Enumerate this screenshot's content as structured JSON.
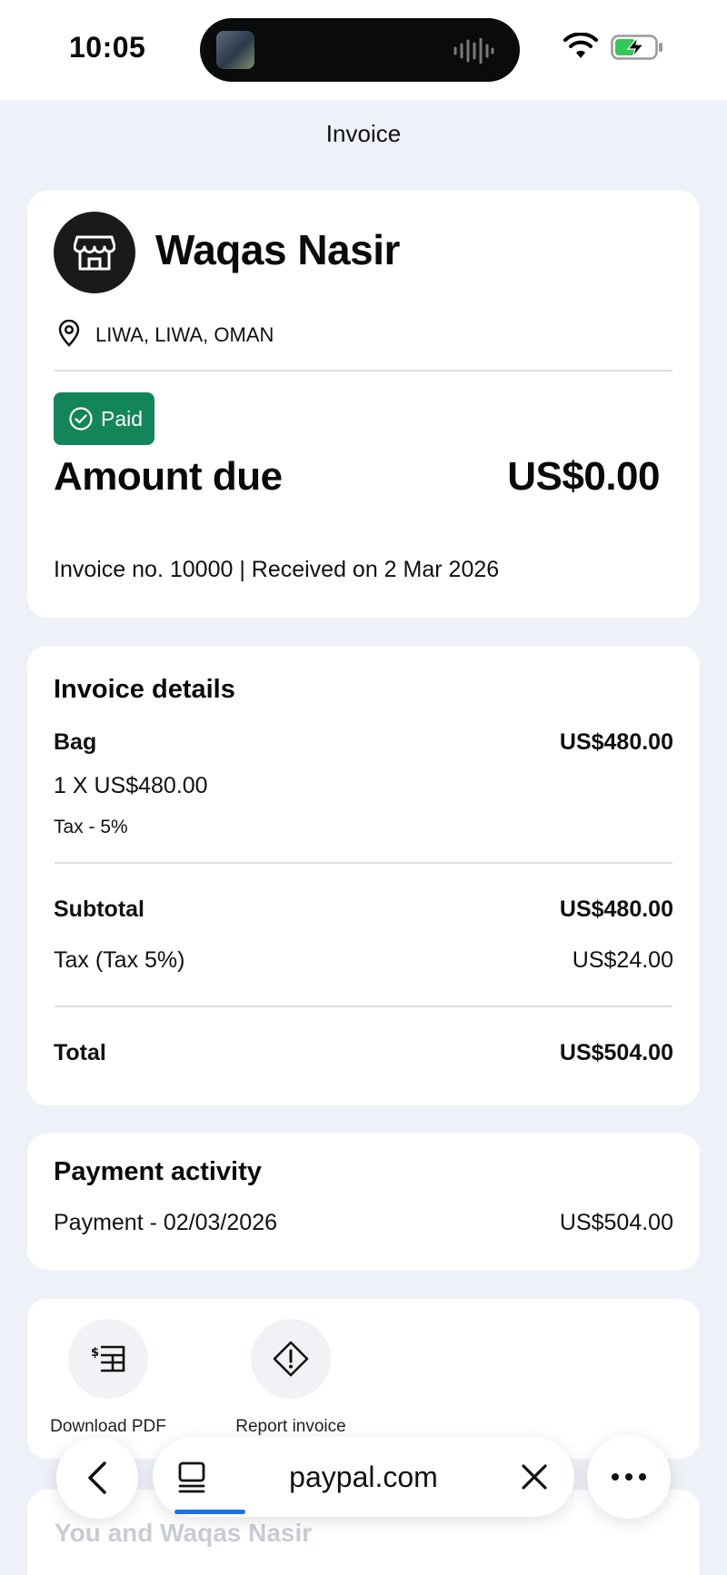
{
  "status_bar": {
    "time": "10:05"
  },
  "nav": {
    "title": "Invoice"
  },
  "merchant": {
    "name": "Waqas Nasir",
    "location": "LIWA, LIWA, OMAN"
  },
  "summary": {
    "status": "Paid",
    "amount_label": "Amount due",
    "amount_value": "US$0.00",
    "meta": "Invoice no. 10000 | Received on 2 Mar 2026",
    "status_color": "#12865a"
  },
  "details": {
    "title": "Invoice details",
    "item": {
      "name": "Bag",
      "amount": "US$480.00",
      "qty_price": "1 X US$480.00",
      "tax": "Tax - 5%"
    },
    "subtotal": {
      "label": "Subtotal",
      "value": "US$480.00"
    },
    "tax_line": {
      "label": "Tax (Tax 5%)",
      "value": "US$24.00"
    },
    "total": {
      "label": "Total",
      "value": "US$504.00"
    }
  },
  "payments": {
    "title": "Payment activity",
    "rows": [
      {
        "label": "Payment - 02/03/2026",
        "value": "US$504.00"
      }
    ]
  },
  "actions": {
    "download": {
      "label": "Download PDF",
      "icon": "invoice-download-icon"
    },
    "report": {
      "label": "Report invoice",
      "icon": "warning-diamond-icon"
    }
  },
  "next_section": {
    "title": "You and Waqas Nasir"
  },
  "browser": {
    "url": "paypal.com",
    "accent": "#1a73e8"
  }
}
